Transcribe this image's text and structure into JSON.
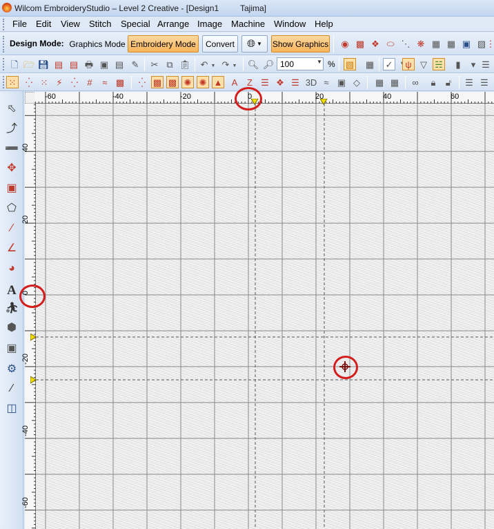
{
  "window": {
    "title": "Wilcom EmbroideryStudio – Level 2 Creative - [Design1",
    "machine_profile": "Tajima]"
  },
  "menu": {
    "items": [
      {
        "label": "File"
      },
      {
        "label": "Edit"
      },
      {
        "label": "View"
      },
      {
        "label": "Stitch"
      },
      {
        "label": "Special"
      },
      {
        "label": "Arrange"
      },
      {
        "label": "Image"
      },
      {
        "label": "Machine"
      },
      {
        "label": "Window"
      },
      {
        "label": "Help"
      }
    ]
  },
  "toolbar": {
    "design_mode_label": "Design Mode:",
    "graphics_mode": "Graphics Mode",
    "embroidery_mode": "Embroidery Mode",
    "convert": "Convert",
    "show_graphics": "Show Graphics",
    "zoom_value": "100",
    "zoom_unit": "%",
    "view_3d": "3D"
  },
  "rulers": {
    "horizontal": [
      "-60",
      "-40",
      "-20",
      "0",
      "20",
      "40",
      "60"
    ],
    "vertical": [
      "40",
      "20",
      "0",
      "-20",
      "-40",
      "-60"
    ]
  },
  "colors": {
    "accent": "#f9b45a",
    "annotation": "#d41c1c",
    "marker": "#f2e000"
  },
  "icons": {
    "left_tools": [
      "select-object-icon",
      "reshape-icon",
      "knife-icon",
      "auto-digitize-icon",
      "transform-icon",
      "outline-icon",
      "run-line-icon",
      "column-icon",
      "satin-circle-icon",
      "lettering-icon",
      "team-names-icon",
      "monogram-icon",
      "border-icon",
      "appliqué-icon",
      "stitch-angle-icon",
      "layout-icon"
    ]
  }
}
